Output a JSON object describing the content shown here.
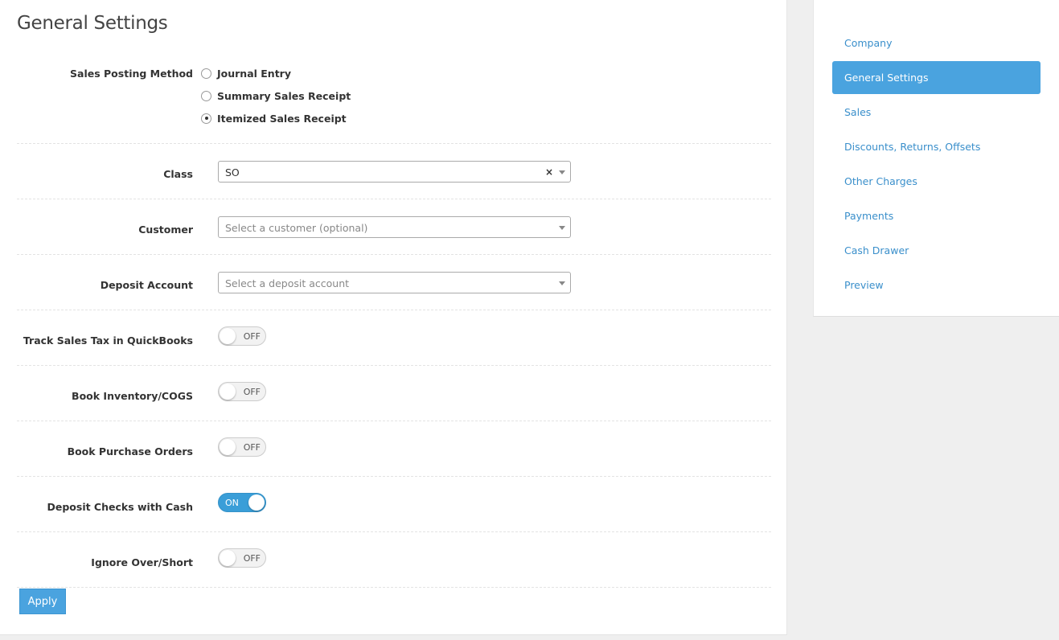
{
  "page": {
    "title": "General Settings"
  },
  "sales_posting": {
    "label": "Sales Posting Method",
    "options": [
      {
        "label": "Journal Entry",
        "checked": false
      },
      {
        "label": "Summary Sales Receipt",
        "checked": false
      },
      {
        "label": "Itemized Sales Receipt",
        "checked": true
      }
    ]
  },
  "class_field": {
    "label": "Class",
    "value": "SO",
    "clear_icon": "×"
  },
  "customer_field": {
    "label": "Customer",
    "placeholder": "Select a customer (optional)"
  },
  "deposit_account_field": {
    "label": "Deposit Account",
    "placeholder": "Select a deposit account"
  },
  "toggles": [
    {
      "label": "Track Sales Tax in QuickBooks",
      "state": "OFF"
    },
    {
      "label": "Book Inventory/COGS",
      "state": "OFF"
    },
    {
      "label": "Book Purchase Orders",
      "state": "OFF"
    },
    {
      "label": "Deposit Checks with Cash",
      "state": "ON"
    },
    {
      "label": "Ignore Over/Short",
      "state": "OFF"
    }
  ],
  "apply_button": {
    "label": "Apply"
  },
  "sidebar": {
    "items": [
      {
        "label": "Company",
        "active": false
      },
      {
        "label": "General Settings",
        "active": true
      },
      {
        "label": "Sales",
        "active": false
      },
      {
        "label": "Discounts, Returns, Offsets",
        "active": false
      },
      {
        "label": "Other Charges",
        "active": false
      },
      {
        "label": "Payments",
        "active": false
      },
      {
        "label": "Cash Drawer",
        "active": false
      },
      {
        "label": "Preview",
        "active": false
      }
    ]
  },
  "colors": {
    "accent": "#4aa3df",
    "toggle_on": "#3a9ed8",
    "link": "#3a8fcb",
    "background": "#efefef"
  }
}
